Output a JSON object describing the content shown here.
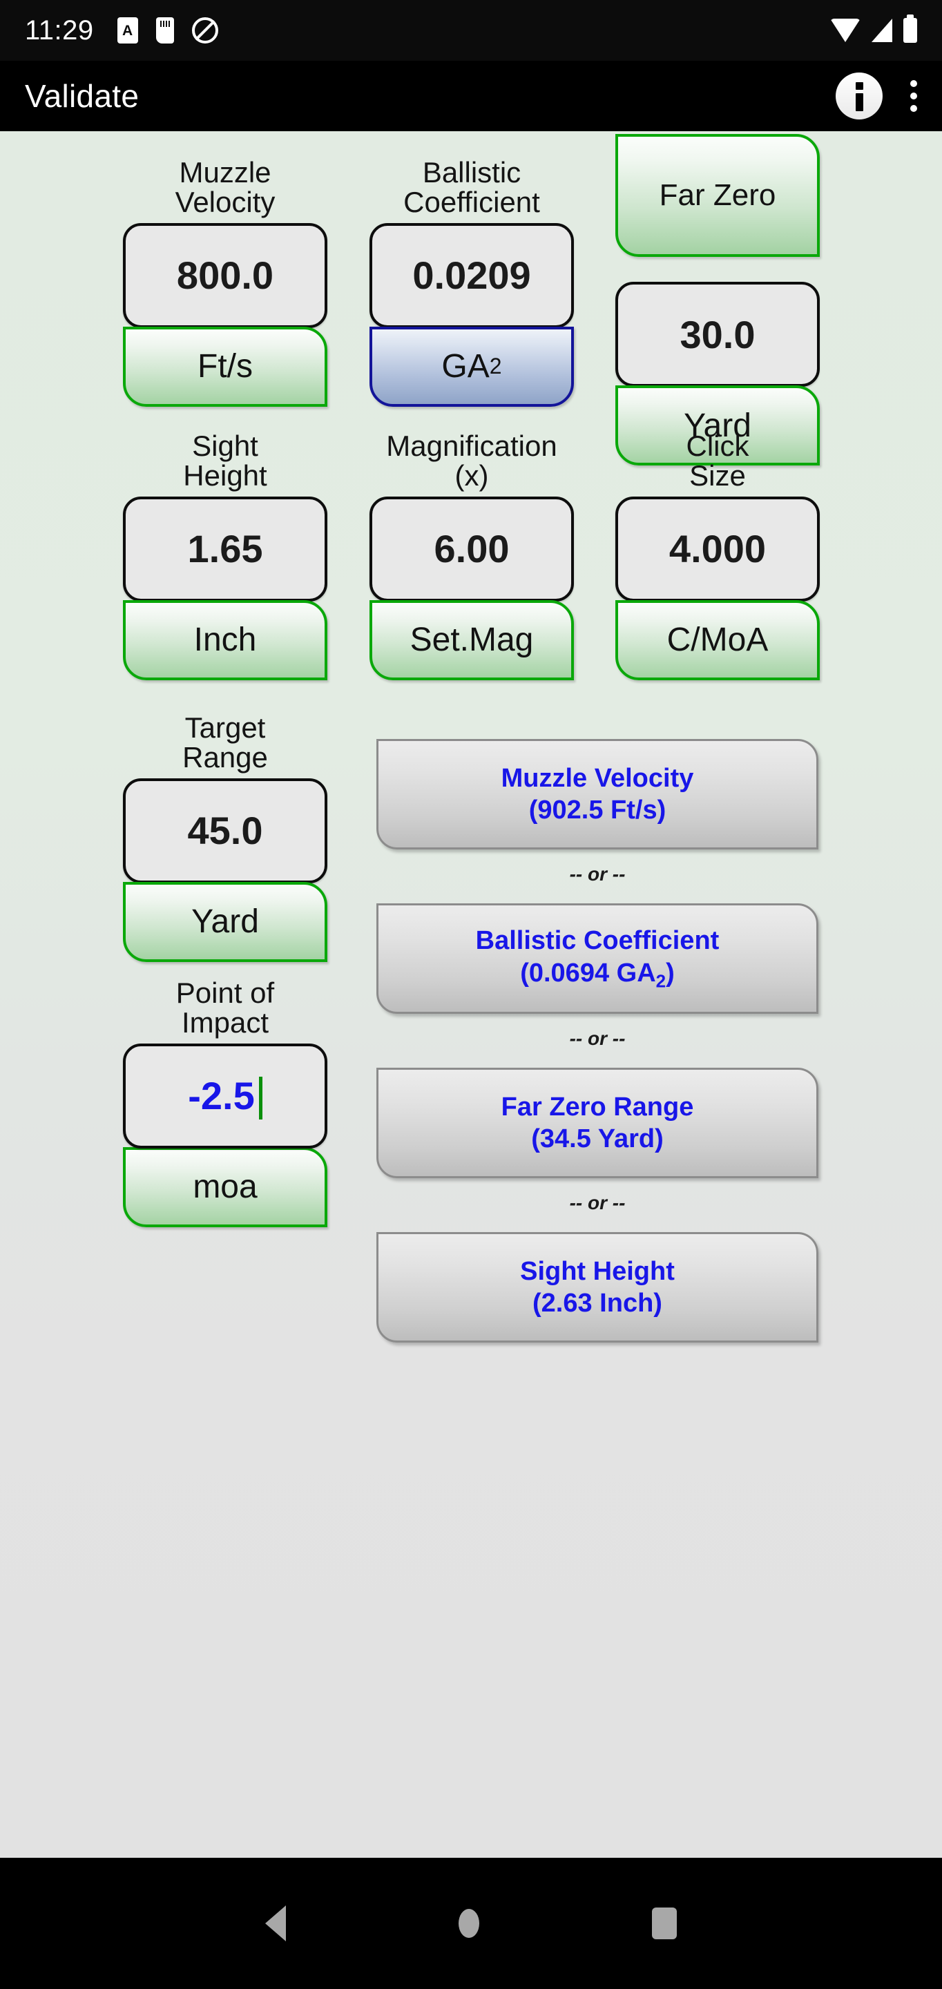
{
  "statusbar": {
    "clock": "11:29",
    "icons_left": [
      "alarm-card-icon",
      "sim-card-icon",
      "mute-icon"
    ],
    "icons_right": [
      "wifi-icon",
      "cell-signal-icon",
      "battery-icon"
    ]
  },
  "appbar": {
    "title": "Validate",
    "info_label": "i",
    "icons": [
      "info-icon",
      "overflow-menu-icon"
    ]
  },
  "header_button": {
    "label": "Far Zero"
  },
  "fields": [
    {
      "name": "muzzle-velocity",
      "label": "Muzzle\nVelocity",
      "label_line1": "Muzzle",
      "label_line2": "Velocity",
      "value": "800.0",
      "unit": "Ft/s",
      "unit_sub": "",
      "unit_style": "green"
    },
    {
      "name": "ballistic-coefficient",
      "label_line1": "Ballistic",
      "label_line2": "Coefficient",
      "value": "0.0209",
      "unit": "GA",
      "unit_sub": "2",
      "unit_style": "blue"
    },
    {
      "name": "far-zero",
      "label_line1": "",
      "label_line2": "",
      "value": "30.0",
      "unit": "Yard",
      "unit_sub": "",
      "unit_style": "green"
    },
    {
      "name": "sight-height",
      "label_line1": "Sight",
      "label_line2": "Height",
      "value": "1.65",
      "unit": "Inch",
      "unit_sub": "",
      "unit_style": "green"
    },
    {
      "name": "magnification",
      "label_line1": "Magnification",
      "label_line2": "(x)",
      "value": "6.00",
      "unit": "Set.Mag",
      "unit_sub": "",
      "unit_style": "green"
    },
    {
      "name": "click-size",
      "label_line1": "Click",
      "label_line2": "Size",
      "value": "4.000",
      "unit": "C/MoA",
      "unit_sub": "",
      "unit_style": "green"
    },
    {
      "name": "target-range",
      "label_line1": "Target",
      "label_line2": "Range",
      "value": "45.0",
      "unit": "Yard",
      "unit_sub": "",
      "unit_style": "green"
    },
    {
      "name": "point-of-impact",
      "label_line1": "Point of",
      "label_line2": "Impact",
      "value": "-2.5",
      "unit": "moa",
      "unit_sub": "",
      "unit_style": "green"
    }
  ],
  "solve_buttons": [
    {
      "name": "solve-muzzle-velocity",
      "line1": "Muzzle Velocity",
      "line2": "(902.5 Ft/s)",
      "line2_sub": ""
    },
    {
      "name": "solve-ballistic-coefficient",
      "line1": "Ballistic Coefficient",
      "line2": "(0.0694 GA",
      "line2_sub": "2",
      "line2_tail": ")"
    },
    {
      "name": "solve-far-zero-range",
      "line1": "Far Zero Range",
      "line2": "(34.5 Yard)",
      "line2_sub": ""
    },
    {
      "name": "solve-sight-height",
      "line1": "Sight Height",
      "line2": "(2.63 Inch)",
      "line2_sub": ""
    }
  ],
  "separator_label": "-- or --",
  "colors": {
    "accent_green": "#0aa80a",
    "accent_blue": "#131499",
    "value_blue": "#1816e8",
    "content_bg": "#e2ebe2",
    "appbar_bg": "#000000"
  }
}
